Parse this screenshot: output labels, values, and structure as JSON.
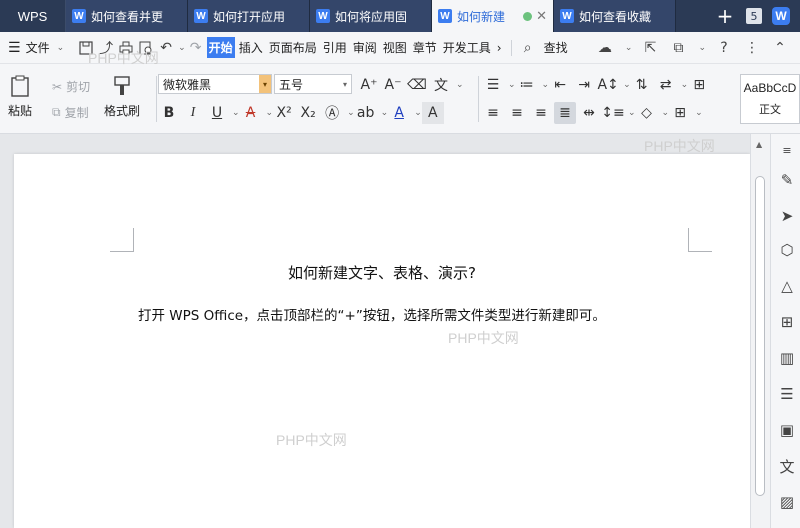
{
  "tabbar": {
    "app_label": "WPS",
    "tabs": [
      {
        "label": "如何查看并更",
        "active": false
      },
      {
        "label": "如何打开应用",
        "active": false
      },
      {
        "label": "如何将应用固",
        "active": false
      },
      {
        "label": "如何新建",
        "active": true
      },
      {
        "label": "如何查看收藏",
        "active": false
      }
    ],
    "tab_count": "5",
    "new_tab_symbol": "+"
  },
  "menubar": {
    "file_label": "文件",
    "tabs": [
      "开始",
      "插入",
      "页面布局",
      "引用",
      "审阅",
      "视图",
      "章节",
      "开发工具"
    ],
    "active_tab": "开始",
    "search_label": "查找",
    "help_symbol": "?",
    "more_symbol": "⋮"
  },
  "ribbon": {
    "paste_label": "粘贴",
    "cut_label": "剪切",
    "copy_label": "复制",
    "format_painter_label": "格式刷",
    "font_name": "微软雅黑",
    "font_size": "五号",
    "style_sample": "AaBbCcD",
    "style_name": "正文",
    "accent_color": "#3c7df0"
  },
  "document": {
    "title": "如何新建文字、表格、演示?",
    "body": "打开 WPS Office，点击顶部栏的“+”按钮，选择所需文件类型进行新建即可。"
  },
  "watermark_text": "PHP中文网",
  "icons": {
    "side_panel": [
      "pen-icon",
      "select-cursor-icon",
      "shapes-icon",
      "fill-icon",
      "apps-grid-icon",
      "chart-icon",
      "settings-sliders-icon",
      "image-icon",
      "translate-icon",
      "picture-icon"
    ]
  }
}
